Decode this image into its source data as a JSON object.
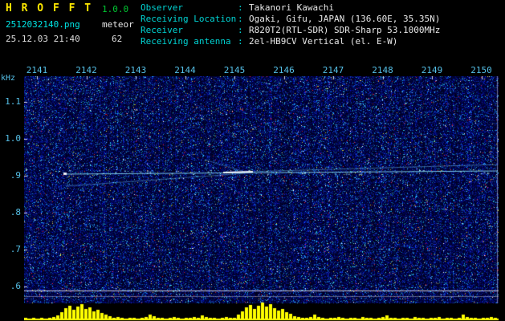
{
  "header": {
    "app_title": "H R O F F T",
    "version": "1.0.0",
    "filename": "2512032140.png",
    "mode": "meteor",
    "datetime": "25.12.03 21:40",
    "count": "62",
    "info_sep": ":",
    "info": [
      {
        "label": "Observer",
        "value": "Takanori Kawachi"
      },
      {
        "label": "Receiving Location",
        "value": "Ogaki, Gifu, JAPAN (136.60E, 35.35N)"
      },
      {
        "label": "Receiver",
        "value": "R820T2(RTL-SDR) SDR-Sharp 53.1000MHz"
      },
      {
        "label": "Receiving antenna",
        "value": "2el-HB9CV Vertical (el. E-W)"
      }
    ]
  },
  "spectrogram": {
    "y_axis_unit": "kHz",
    "x_ticks": [
      "2141",
      "2142",
      "2143",
      "2144",
      "2145",
      "2146",
      "2147",
      "2148",
      "2149",
      "2150"
    ],
    "y_ticks": [
      "1.1",
      "1.0",
      ".9",
      ".8",
      ".7",
      ".6"
    ],
    "echo_trace_khz": 0.91,
    "colors": {
      "noise_background": "#000022",
      "trace": "#8ce0ff",
      "bars": "#ffff00",
      "tick_text": "#55c0e8",
      "title": "#ffe800",
      "version": "#00c832",
      "filename": "#00e5e5"
    }
  },
  "signal_bars": [
    2,
    1,
    2,
    1,
    2,
    1,
    2,
    3,
    5,
    9,
    14,
    17,
    12,
    16,
    19,
    13,
    15,
    10,
    12,
    8,
    6,
    4,
    2,
    3,
    2,
    1,
    2,
    2,
    1,
    2,
    3,
    6,
    4,
    2,
    2,
    1,
    2,
    3,
    2,
    1,
    2,
    2,
    3,
    2,
    5,
    3,
    2,
    2,
    1,
    2,
    3,
    2,
    2,
    6,
    10,
    15,
    18,
    13,
    17,
    21,
    16,
    19,
    14,
    11,
    13,
    9,
    7,
    4,
    3,
    2,
    2,
    3,
    6,
    3,
    2,
    1,
    2,
    2,
    3,
    2,
    1,
    2,
    2,
    1,
    3,
    2,
    2,
    1,
    2,
    3,
    5,
    2,
    2,
    1,
    2,
    2,
    1,
    3,
    2,
    2,
    1,
    2,
    2,
    3,
    1,
    2,
    2,
    1,
    2,
    6,
    3,
    2,
    2,
    1,
    2,
    2,
    3,
    2
  ]
}
